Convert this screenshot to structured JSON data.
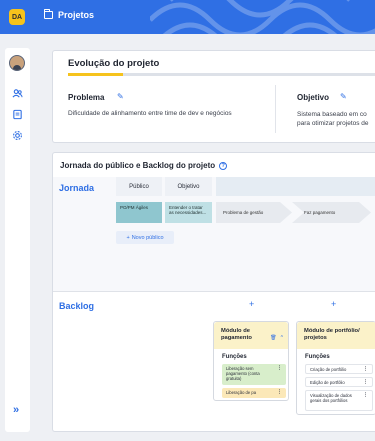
{
  "topbar": {
    "logo_text": "DA",
    "title": "Projetos"
  },
  "sidebar": {
    "items": [
      {
        "name": "users-icon"
      },
      {
        "name": "document-icon"
      },
      {
        "name": "gear-icon"
      }
    ],
    "collapse_label": "»"
  },
  "evolution": {
    "title": "Evolução do projeto",
    "progress_fraction": 0.18,
    "problem_label": "Problema",
    "problem_text": "Dificuldade de alinhamento entre time de dev e negócios",
    "objective_label": "Objetivo",
    "objective_text_line1": "Sistema baseado em co",
    "objective_text_line2": "para otimizar projetos de"
  },
  "journey": {
    "title": "Jornada do público e Backlog do projeto",
    "help_glyph": "?",
    "jornada_label": "Jornada",
    "col_public": "Público",
    "col_objective": "Objetivo",
    "cell_public": "PO/PM Ágiles",
    "cell_objective": "Entender o tratar as necessidades...",
    "step1": "Problema de gestão",
    "step2": "Faz pagamento",
    "add_public_label": "Novo público",
    "add_public_plus": "+"
  },
  "backlog": {
    "label": "Backlog",
    "plus": "+",
    "module1": {
      "title_line1": "Módulo de",
      "title_line2": "pagamento",
      "functions_label": "Funções",
      "feat1": "Liberação sem pagamento (conta gratuita)",
      "feat2": "Liberação de pa"
    },
    "module2": {
      "title_line1": "Módulo de portfólio/",
      "title_line2": "projetos",
      "functions_label": "Funções",
      "feat1": "Criação de portfólio",
      "feat2": "Edição de portfólio",
      "feat3": "Visualização de dados gerais dos portfólios"
    }
  },
  "colors": {
    "primary": "#2f6fe4",
    "accent": "#f6c31c"
  }
}
